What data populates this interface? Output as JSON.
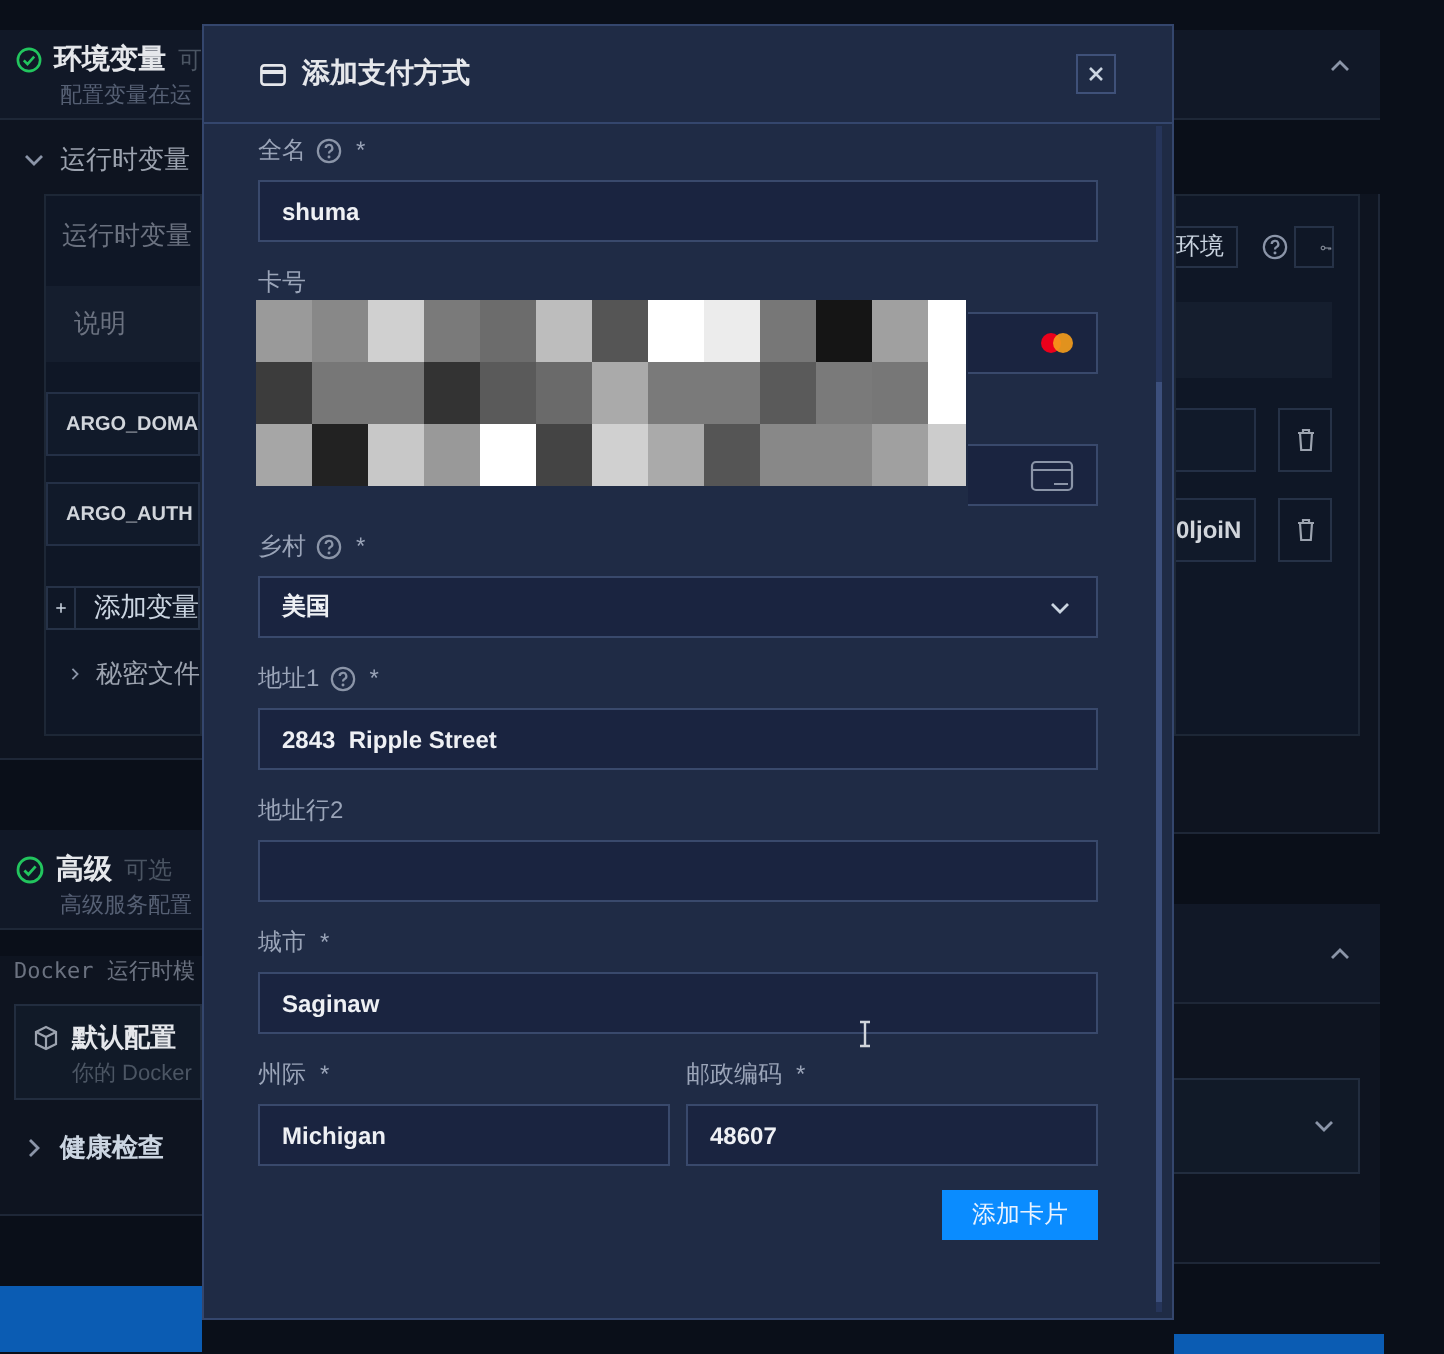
{
  "background": {
    "env_section": {
      "title": "环境变量",
      "tag": "可",
      "subtitle": "配置变量在运"
    },
    "runtime_group": {
      "title": "运行时变量",
      "expanded": true
    },
    "runtime_label": "运行时变量",
    "env_button": "环境",
    "table_header": "说明",
    "variables": [
      {
        "name": "ARGO_DOMA"
      },
      {
        "name": "ARGO_AUTH",
        "value": "0ljoiN"
      }
    ],
    "add_button": "添加变量",
    "secret_files": {
      "title": "秘密文件",
      "expanded": false
    },
    "advanced_section": {
      "title": "高级",
      "tag": "可选",
      "subtitle": "高级服务配置"
    },
    "docker_label": "Docker 运行时模",
    "docker_card": {
      "title": "默认配置",
      "subtitle": "你的 Docker"
    },
    "health_check": {
      "title": "健康检查",
      "expanded": false
    }
  },
  "dialog": {
    "title": "添加支付方式",
    "rows": [
      {
        "kind": "text",
        "label": "全名",
        "help": true,
        "mark": "*",
        "value": "shuma"
      },
      {
        "kind": "card",
        "label": "卡号"
      },
      {
        "kind": "expiry-cvc"
      },
      {
        "kind": "select",
        "label": "乡村",
        "help": true,
        "mark": "*",
        "value": "美国"
      },
      {
        "kind": "text",
        "label": "地址1",
        "help": true,
        "mark": "*",
        "value": "2843  Ripple Street"
      },
      {
        "kind": "text",
        "label": "地址行2"
      },
      {
        "kind": "text",
        "label": "城市",
        "mark": "*",
        "value": "Saginaw"
      },
      {
        "kind": "pair",
        "fields": [
          {
            "label": "州际",
            "mark": "*",
            "value": "Michigan"
          },
          {
            "label": "邮政编码",
            "mark": "*",
            "value": "48607"
          }
        ]
      }
    ],
    "submit": "添加卡片"
  }
}
